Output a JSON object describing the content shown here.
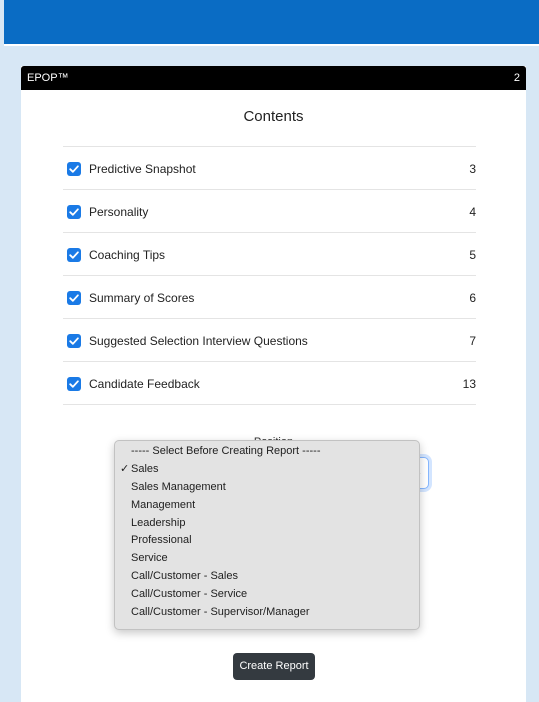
{
  "header": {
    "brand": "EPOP™",
    "page_number": "2"
  },
  "contents": {
    "title": "Contents",
    "items": [
      {
        "label": "Predictive Snapshot",
        "page": "3",
        "checked": true
      },
      {
        "label": "Personality",
        "page": "4",
        "checked": true
      },
      {
        "label": "Coaching Tips",
        "page": "5",
        "checked": true
      },
      {
        "label": "Summary of Scores",
        "page": "6",
        "checked": true
      },
      {
        "label": "Suggested Selection Interview Questions",
        "page": "7",
        "checked": true
      },
      {
        "label": "Candidate Feedback",
        "page": "13",
        "checked": true
      }
    ]
  },
  "position": {
    "label": "Position",
    "selected": "Sales",
    "options": [
      "----- Select Before Creating Report -----",
      "Sales",
      "Sales Management",
      "Management",
      "Leadership",
      "Professional",
      "Service",
      "Call/Customer - Sales",
      "Call/Customer - Service",
      "Call/Customer - Supervisor/Manager"
    ]
  },
  "actions": {
    "create_report_label": "Create Report"
  },
  "colors": {
    "top_bar": "#0a6cc4",
    "background": "#d7e7f5",
    "checkbox": "#1a7ae6",
    "button": "#343a40"
  }
}
